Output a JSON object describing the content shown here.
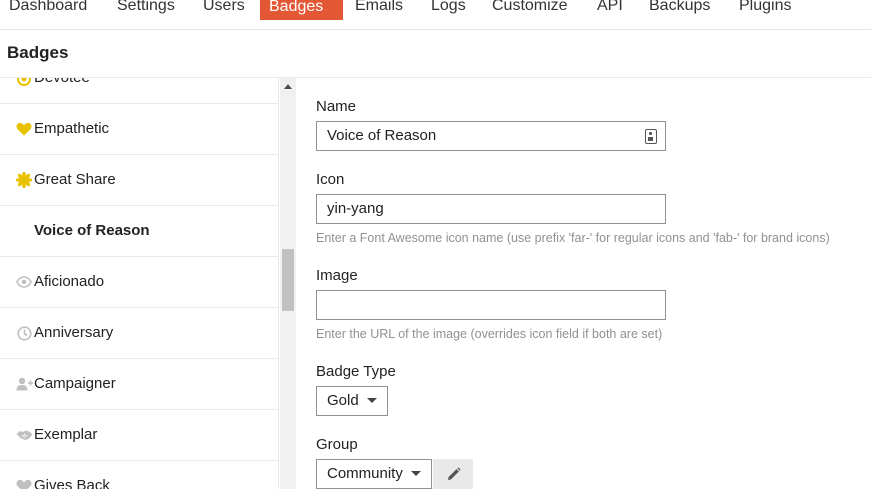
{
  "nav": {
    "items": [
      {
        "label": "Dashboard",
        "active": false
      },
      {
        "label": "Settings",
        "active": false
      },
      {
        "label": "Users",
        "active": false
      },
      {
        "label": "Badges",
        "active": true
      },
      {
        "label": "Emails",
        "active": false
      },
      {
        "label": "Logs",
        "active": false
      },
      {
        "label": "Customize",
        "active": false
      },
      {
        "label": "API",
        "active": false
      },
      {
        "label": "Backups",
        "active": false
      },
      {
        "label": "Plugins",
        "active": false
      }
    ],
    "active_color": "#e45735"
  },
  "page": {
    "title": "Badges"
  },
  "badges": [
    {
      "label": "Devotee",
      "icon": "sun-icon",
      "color": "#e7c200"
    },
    {
      "label": "Empathetic",
      "icon": "heart-icon",
      "color": "#e7c200"
    },
    {
      "label": "Great Share",
      "icon": "certificate-icon",
      "color": "#e7c200"
    },
    {
      "label": "Voice of Reason",
      "icon": "",
      "color": "",
      "selected": true
    },
    {
      "label": "Aficionado",
      "icon": "eye-icon",
      "color": "#c0c0c0"
    },
    {
      "label": "Anniversary",
      "icon": "clock-icon",
      "color": "#c0c0c0"
    },
    {
      "label": "Campaigner",
      "icon": "user-plus-icon",
      "color": "#c0c0c0"
    },
    {
      "label": "Exemplar",
      "icon": "handshake-icon",
      "color": "#c0c0c0"
    },
    {
      "label": "Gives Back",
      "icon": "heart-icon",
      "color": "#c0c0c0"
    }
  ],
  "form": {
    "name_label": "Name",
    "name_value": "Voice of Reason",
    "icon_label": "Icon",
    "icon_value": "yin-yang",
    "icon_help": "Enter a Font Awesome icon name (use prefix 'far-' for regular icons and 'fab-' for brand icons)",
    "image_label": "Image",
    "image_value": "",
    "image_help": "Enter the URL of the image (overrides icon field if both are set)",
    "badge_type_label": "Badge Type",
    "badge_type_value": "Gold",
    "group_label": "Group",
    "group_value": "Community"
  }
}
